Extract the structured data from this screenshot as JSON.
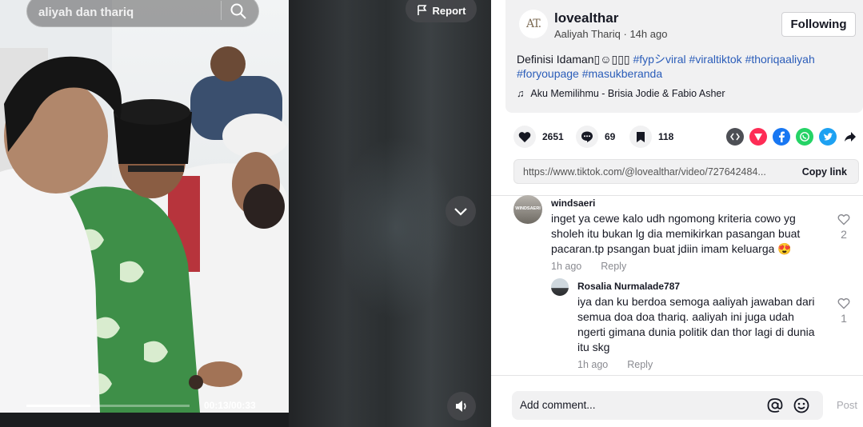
{
  "video": {
    "search_text": "aliyah dan thariq",
    "report_label": "Report",
    "time": "00:13/00:33",
    "progress": 0.39
  },
  "post": {
    "avatar_text": "AT.",
    "username": "lovealthar",
    "author": "Aaliyah Thariq",
    "separator": " · ",
    "posted": "14h ago",
    "follow_label": "Following",
    "caption_text": "Definisi Idaman▯☺▯▯▯ ",
    "hashtags": [
      "#fypシviral",
      "#viraltiktok",
      "#thoriqaaliyah",
      "#foryoupage",
      "#masukberanda"
    ],
    "music": "Aku Memilihmu - Brisia Jodie & Fabio Asher"
  },
  "actions": {
    "likes": "2651",
    "comments": "69",
    "saves": "118"
  },
  "share_icons": [
    {
      "name": "embed-icon",
      "color": "#4d4f55"
    },
    {
      "name": "friends-send-icon",
      "color": "#fe2c55"
    },
    {
      "name": "facebook-icon",
      "color": "#1877f2"
    },
    {
      "name": "whatsapp-icon",
      "color": "#25d366"
    },
    {
      "name": "twitter-icon",
      "color": "#1da1f2"
    }
  ],
  "link": {
    "url": "https://www.tiktok.com/@lovealthar/video/727642484...",
    "copy_label": "Copy link"
  },
  "comments": [
    {
      "username": "windsaeri",
      "avatar_text": "WINDSAERI",
      "text": "inget ya cewe kalo udh ngomong kriteria cowo yg sholeh itu bukan lg dia memikirkan pasangan buat pacaran.tp psangan buat jdiin imam keluarga 😍",
      "time": "1h ago",
      "reply_label": "Reply",
      "likes": "2"
    },
    {
      "username": "Rosalia Nurmalade787",
      "text": "iya dan ku berdoa semoga aaliyah jawaban dari semua doa doa thariq. aaliyah ini juga udah ngerti gimana dunia politik dan thor lagi di dunia itu skg",
      "time": "1h ago",
      "reply_label": "Reply",
      "likes": "1"
    }
  ],
  "composer": {
    "placeholder": "Add comment...",
    "post_label": "Post"
  }
}
